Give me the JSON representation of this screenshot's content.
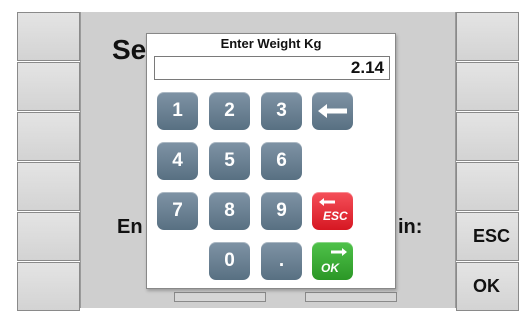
{
  "background": {
    "title_fragment": "Se",
    "entry_fragment": "En",
    "suffix_fragment": "in:"
  },
  "right_buttons": [
    {
      "label": ""
    },
    {
      "label": ""
    },
    {
      "label": ""
    },
    {
      "label": ""
    },
    {
      "label": "ESC"
    },
    {
      "label": "OK"
    }
  ],
  "keypad": {
    "title": "Enter Weight Kg",
    "display_value": "2.14",
    "keys": [
      "1",
      "2",
      "3",
      "4",
      "5",
      "6",
      "7",
      "8",
      "9",
      "0",
      "."
    ],
    "backspace_icon": "left-arrow-icon",
    "esc_label": "ESC",
    "ok_label": "OK"
  },
  "colors": {
    "key": "#6a8193",
    "esc": "#e53039",
    "ok": "#3aa935"
  }
}
